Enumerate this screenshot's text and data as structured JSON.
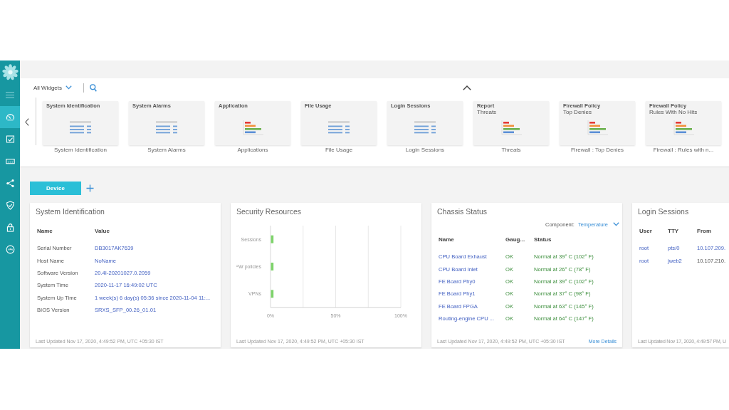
{
  "sidebar": {
    "items": [
      {
        "selected": true
      },
      {
        "selected": false
      },
      {
        "selected": false
      },
      {
        "selected": false
      },
      {
        "selected": false
      },
      {
        "selected": false
      },
      {
        "selected": false
      }
    ]
  },
  "widget_picker": {
    "filter": {
      "value": "All Widgets"
    },
    "widgets": [
      {
        "kind": "table",
        "heading": "System Identification",
        "caption": "System Identification"
      },
      {
        "kind": "table",
        "heading": "System Alarms",
        "caption": "System Alarms"
      },
      {
        "kind": "bar",
        "heading": "Application",
        "caption": "Applications"
      },
      {
        "kind": "table",
        "heading": "File Usage",
        "caption": "File Usage"
      },
      {
        "kind": "table",
        "heading": "Login Sessions",
        "caption": "Login Sessions"
      },
      {
        "kind": "bar",
        "category": "Report",
        "heading": "Threats",
        "caption": "Threats"
      },
      {
        "kind": "bar",
        "category": "Firewall Policy",
        "heading": "Top Denies",
        "caption": "Firewall : Top Denies"
      },
      {
        "kind": "bar",
        "category": "Firewall Policy",
        "heading": "Rules With No Hits",
        "caption": "Firewall : Rules with n..."
      }
    ]
  },
  "dashboard_tabs": [
    {
      "label": "Device",
      "selected": true
    }
  ],
  "cards": [
    {
      "kind": "table",
      "title": "System Identification",
      "columns": [
        "Name",
        "Value"
      ],
      "rows": [
        [
          {
            "text": "Serial Number",
            "kind": "plain"
          },
          {
            "text": "DB3017AK7639",
            "kind": "link"
          }
        ],
        [
          {
            "text": "Host Name",
            "kind": "plain"
          },
          {
            "text": "NoName",
            "kind": "link"
          }
        ],
        [
          {
            "text": "Software Version",
            "kind": "plain"
          },
          {
            "text": "20.4I-20201027.0.2059",
            "kind": "link"
          }
        ],
        [
          {
            "text": "System Time",
            "kind": "plain"
          },
          {
            "text": "2020-11-17 16:49:02 UTC",
            "kind": "link"
          }
        ],
        [
          {
            "text": "System Up Time",
            "kind": "plain"
          },
          {
            "text": "1 week(s) 6 day(s) 05:36 since 2020-11-04 11:...",
            "kind": "link"
          }
        ],
        [
          {
            "text": "BIOS Version",
            "kind": "plain"
          },
          {
            "text": "SRXS_SFP_00.26_01.01",
            "kind": "link"
          }
        ]
      ],
      "footer": "Last Updated Nov 17, 2020, 4:49:52 PM, UTC +05:30 IST"
    },
    {
      "kind": "chart",
      "title": "Security Resources",
      "chart_data": {
        "type": "bar",
        "orientation": "horizontal",
        "categories": [
          "Sessions",
          "FW policies",
          "VPNs"
        ],
        "values": [
          2,
          2,
          2
        ],
        "xlim": [
          0,
          100
        ],
        "xticks": [
          {
            "value": 0,
            "label": "0%"
          },
          {
            "value": 50,
            "label": "50%"
          },
          {
            "value": 100,
            "label": "100%"
          }
        ]
      },
      "footer": "Last Updated Nov 17, 2020, 4:49:52 PM, UTC +05:30 IST"
    },
    {
      "kind": "table",
      "title": "Chassis Status",
      "component": {
        "label": "Component:",
        "value": "Temperature"
      },
      "columns": [
        "Name",
        "Gaug...",
        "Status"
      ],
      "rows": [
        [
          {
            "text": "CPU Board Exhaust",
            "kind": "link"
          },
          {
            "text": "OK",
            "kind": "ok"
          },
          {
            "text": "Normal at 39° C (102° F)",
            "kind": "ok"
          }
        ],
        [
          {
            "text": "CPU Board Inlet",
            "kind": "link"
          },
          {
            "text": "OK",
            "kind": "ok"
          },
          {
            "text": "Normal at 26° C (78° F)",
            "kind": "ok"
          }
        ],
        [
          {
            "text": "FE Board Phy0",
            "kind": "link"
          },
          {
            "text": "OK",
            "kind": "ok"
          },
          {
            "text": "Normal at 39° C (102° F)",
            "kind": "ok"
          }
        ],
        [
          {
            "text": "FE Board Phy1",
            "kind": "link"
          },
          {
            "text": "OK",
            "kind": "ok"
          },
          {
            "text": "Normal at 37° C (98° F)",
            "kind": "ok"
          }
        ],
        [
          {
            "text": "FE Board FPGA",
            "kind": "link"
          },
          {
            "text": "OK",
            "kind": "ok"
          },
          {
            "text": "Normal at 63° C (145° F)",
            "kind": "ok"
          }
        ],
        [
          {
            "text": "Routing-engine CPU ...",
            "kind": "link"
          },
          {
            "text": "OK",
            "kind": "ok"
          },
          {
            "text": "Normal at 64° C (147° F)",
            "kind": "ok"
          }
        ]
      ],
      "footer": "Last Updated Nov 17, 2020, 4:49:52 PM, UTC +05:30 IST",
      "link": "More Details"
    },
    {
      "kind": "table",
      "title": "Login Sessions",
      "columns": [
        "User",
        "TTY",
        "From"
      ],
      "rows": [
        [
          {
            "text": "root",
            "kind": "link"
          },
          {
            "text": "pts/0",
            "kind": "link"
          },
          {
            "text": "10.107.209.",
            "kind": "link"
          }
        ],
        [
          {
            "text": "root",
            "kind": "link"
          },
          {
            "text": "jweb2",
            "kind": "link"
          },
          {
            "text": "10.107.210.",
            "kind": "plain"
          }
        ]
      ],
      "footer": "Last Updated Nov 17, 2020, 4:49:57 PM, U"
    }
  ]
}
